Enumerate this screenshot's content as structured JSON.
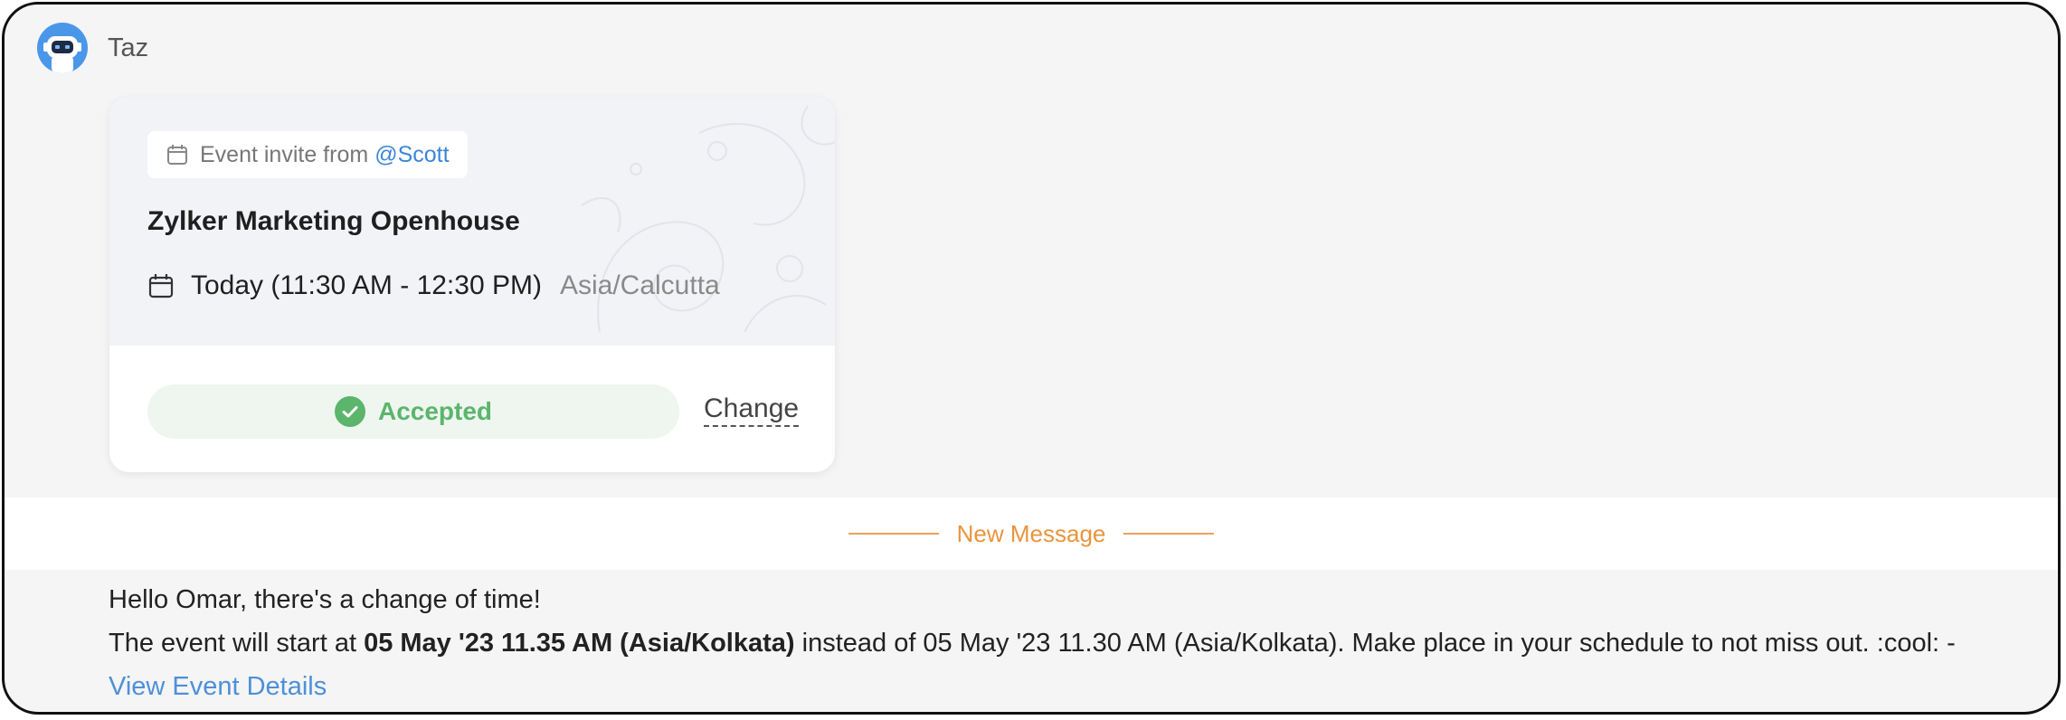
{
  "bot": {
    "name": "Taz",
    "avatar_icon": "robot-icon"
  },
  "card": {
    "invite_prefix": "Event invite from",
    "invite_mention": "@Scott",
    "title": "Zylker Marketing Openhouse",
    "time": "Today (11:30 AM - 12:30 PM)",
    "timezone": "Asia/Calcutta",
    "status": "Accepted",
    "change_label": "Change"
  },
  "divider": {
    "label": "New Message"
  },
  "message": {
    "greeting": "Hello Omar, there's a change of time!",
    "line2_prefix": "The event will start at ",
    "line2_bold": "05 May '23 11.35 AM (Asia/Kolkata)",
    "line2_suffix": " instead of 05 May '23 11.30 AM (Asia/Kolkata). Make place in your schedule to not miss out. :cool: -",
    "link": "View Event Details"
  },
  "colors": {
    "accent_blue": "#4a97ea",
    "mention_blue": "#3b86d6",
    "accepted_green": "#5bb56c",
    "divider_orange": "#e9943d"
  }
}
